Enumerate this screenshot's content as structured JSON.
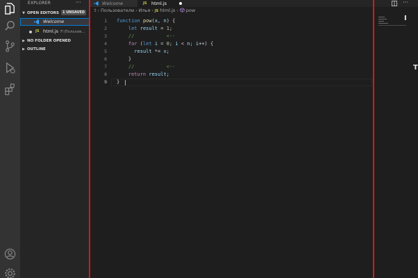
{
  "activity_bar": {
    "icons": [
      "files-icon",
      "search-icon",
      "source-control-icon",
      "run-debug-icon",
      "extensions-icon",
      "account-icon",
      "gear-icon"
    ]
  },
  "sidebar": {
    "title": "EXPLORER",
    "more": "···",
    "open_editors": {
      "label": "OPEN EDITORS",
      "badge": "1 UNSAVED",
      "items": [
        {
          "name": "Welcome",
          "path": ""
        },
        {
          "name": "html.js",
          "path": "F:\\Пользов..."
        }
      ]
    },
    "no_folder_label": "NO FOLDER OPENED",
    "outline_label": "OUTLINE"
  },
  "tabs": [
    {
      "label": "Welcome"
    },
    {
      "label": "html.js"
    }
  ],
  "breadcrumb": {
    "segments": [
      "t",
      "Пользователи",
      "Илья",
      "html.js",
      "pow"
    ]
  },
  "editor": {
    "active_line": 9,
    "line_numbers": [
      "1",
      "2",
      "3",
      "4",
      "5",
      "6",
      "7",
      "8",
      "9"
    ]
  },
  "right_panel": {
    "more": "···",
    "glyph_top": "I",
    "glyph_mid": "T"
  },
  "colors": {
    "accent": "#007fd4",
    "guide_red": "#e51414",
    "js_icon": "#cbcb41"
  }
}
